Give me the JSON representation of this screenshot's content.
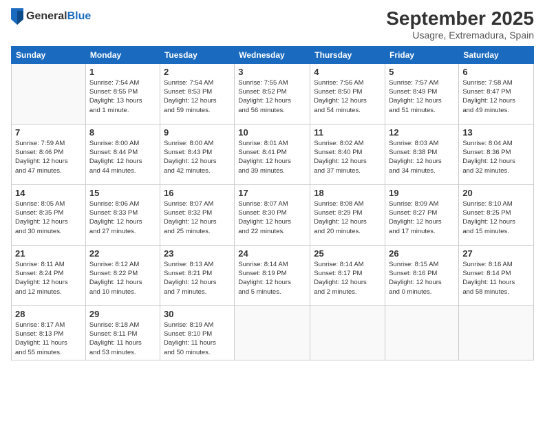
{
  "header": {
    "logo_general": "General",
    "logo_blue": "Blue",
    "month_year": "September 2025",
    "location": "Usagre, Extremadura, Spain"
  },
  "weekdays": [
    "Sunday",
    "Monday",
    "Tuesday",
    "Wednesday",
    "Thursday",
    "Friday",
    "Saturday"
  ],
  "weeks": [
    [
      {
        "day": "",
        "info": ""
      },
      {
        "day": "1",
        "info": "Sunrise: 7:54 AM\nSunset: 8:55 PM\nDaylight: 13 hours\nand 1 minute."
      },
      {
        "day": "2",
        "info": "Sunrise: 7:54 AM\nSunset: 8:53 PM\nDaylight: 12 hours\nand 59 minutes."
      },
      {
        "day": "3",
        "info": "Sunrise: 7:55 AM\nSunset: 8:52 PM\nDaylight: 12 hours\nand 56 minutes."
      },
      {
        "day": "4",
        "info": "Sunrise: 7:56 AM\nSunset: 8:50 PM\nDaylight: 12 hours\nand 54 minutes."
      },
      {
        "day": "5",
        "info": "Sunrise: 7:57 AM\nSunset: 8:49 PM\nDaylight: 12 hours\nand 51 minutes."
      },
      {
        "day": "6",
        "info": "Sunrise: 7:58 AM\nSunset: 8:47 PM\nDaylight: 12 hours\nand 49 minutes."
      }
    ],
    [
      {
        "day": "7",
        "info": "Sunrise: 7:59 AM\nSunset: 8:46 PM\nDaylight: 12 hours\nand 47 minutes."
      },
      {
        "day": "8",
        "info": "Sunrise: 8:00 AM\nSunset: 8:44 PM\nDaylight: 12 hours\nand 44 minutes."
      },
      {
        "day": "9",
        "info": "Sunrise: 8:00 AM\nSunset: 8:43 PM\nDaylight: 12 hours\nand 42 minutes."
      },
      {
        "day": "10",
        "info": "Sunrise: 8:01 AM\nSunset: 8:41 PM\nDaylight: 12 hours\nand 39 minutes."
      },
      {
        "day": "11",
        "info": "Sunrise: 8:02 AM\nSunset: 8:40 PM\nDaylight: 12 hours\nand 37 minutes."
      },
      {
        "day": "12",
        "info": "Sunrise: 8:03 AM\nSunset: 8:38 PM\nDaylight: 12 hours\nand 34 minutes."
      },
      {
        "day": "13",
        "info": "Sunrise: 8:04 AM\nSunset: 8:36 PM\nDaylight: 12 hours\nand 32 minutes."
      }
    ],
    [
      {
        "day": "14",
        "info": "Sunrise: 8:05 AM\nSunset: 8:35 PM\nDaylight: 12 hours\nand 30 minutes."
      },
      {
        "day": "15",
        "info": "Sunrise: 8:06 AM\nSunset: 8:33 PM\nDaylight: 12 hours\nand 27 minutes."
      },
      {
        "day": "16",
        "info": "Sunrise: 8:07 AM\nSunset: 8:32 PM\nDaylight: 12 hours\nand 25 minutes."
      },
      {
        "day": "17",
        "info": "Sunrise: 8:07 AM\nSunset: 8:30 PM\nDaylight: 12 hours\nand 22 minutes."
      },
      {
        "day": "18",
        "info": "Sunrise: 8:08 AM\nSunset: 8:29 PM\nDaylight: 12 hours\nand 20 minutes."
      },
      {
        "day": "19",
        "info": "Sunrise: 8:09 AM\nSunset: 8:27 PM\nDaylight: 12 hours\nand 17 minutes."
      },
      {
        "day": "20",
        "info": "Sunrise: 8:10 AM\nSunset: 8:25 PM\nDaylight: 12 hours\nand 15 minutes."
      }
    ],
    [
      {
        "day": "21",
        "info": "Sunrise: 8:11 AM\nSunset: 8:24 PM\nDaylight: 12 hours\nand 12 minutes."
      },
      {
        "day": "22",
        "info": "Sunrise: 8:12 AM\nSunset: 8:22 PM\nDaylight: 12 hours\nand 10 minutes."
      },
      {
        "day": "23",
        "info": "Sunrise: 8:13 AM\nSunset: 8:21 PM\nDaylight: 12 hours\nand 7 minutes."
      },
      {
        "day": "24",
        "info": "Sunrise: 8:14 AM\nSunset: 8:19 PM\nDaylight: 12 hours\nand 5 minutes."
      },
      {
        "day": "25",
        "info": "Sunrise: 8:14 AM\nSunset: 8:17 PM\nDaylight: 12 hours\nand 2 minutes."
      },
      {
        "day": "26",
        "info": "Sunrise: 8:15 AM\nSunset: 8:16 PM\nDaylight: 12 hours\nand 0 minutes."
      },
      {
        "day": "27",
        "info": "Sunrise: 8:16 AM\nSunset: 8:14 PM\nDaylight: 11 hours\nand 58 minutes."
      }
    ],
    [
      {
        "day": "28",
        "info": "Sunrise: 8:17 AM\nSunset: 8:13 PM\nDaylight: 11 hours\nand 55 minutes."
      },
      {
        "day": "29",
        "info": "Sunrise: 8:18 AM\nSunset: 8:11 PM\nDaylight: 11 hours\nand 53 minutes."
      },
      {
        "day": "30",
        "info": "Sunrise: 8:19 AM\nSunset: 8:10 PM\nDaylight: 11 hours\nand 50 minutes."
      },
      {
        "day": "",
        "info": ""
      },
      {
        "day": "",
        "info": ""
      },
      {
        "day": "",
        "info": ""
      },
      {
        "day": "",
        "info": ""
      }
    ]
  ]
}
